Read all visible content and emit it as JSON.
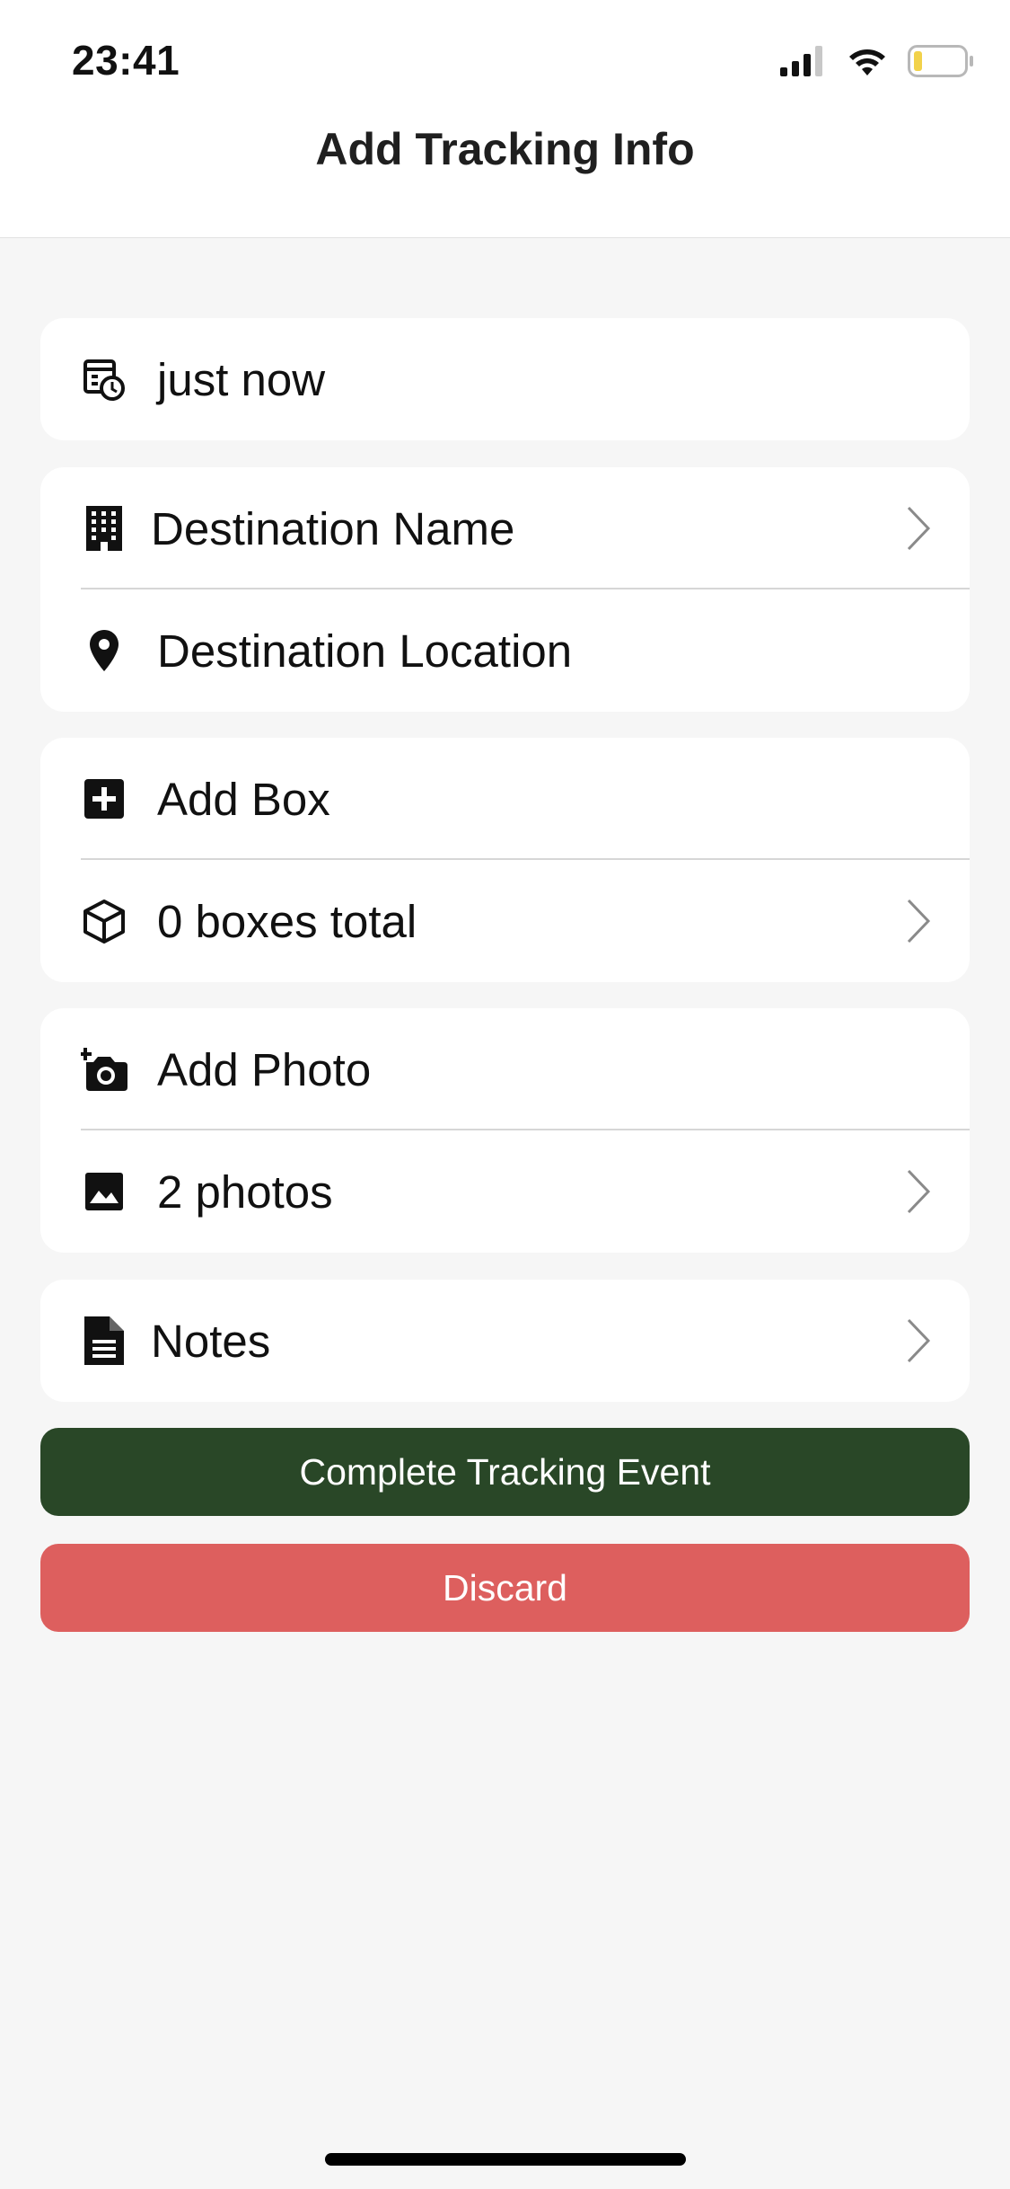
{
  "status_bar": {
    "time": "23:41",
    "battery_color": "#f2d24a",
    "icons": [
      "signal-icon",
      "wifi-icon",
      "battery-icon"
    ]
  },
  "nav": {
    "title": "Add Tracking Info"
  },
  "sections": {
    "time": {
      "label": "just now",
      "icon": "calendar-clock-icon"
    },
    "destination": {
      "name_label": "Destination Name",
      "name_icon": "building-icon",
      "location_label": "Destination Location",
      "location_icon": "map-pin-icon"
    },
    "boxes": {
      "add_label": "Add Box",
      "add_icon": "plus-square-icon",
      "total_label": "0 boxes total",
      "total_icon": "box-icon"
    },
    "photos": {
      "add_label": "Add Photo",
      "add_icon": "add-camera-icon",
      "count_label": "2 photos",
      "count_icon": "image-icon"
    },
    "notes": {
      "label": "Notes",
      "icon": "document-icon"
    }
  },
  "actions": {
    "complete_label": "Complete Tracking Event",
    "complete_color": "#294727",
    "discard_label": "Discard",
    "discard_color": "#dd5f5e"
  }
}
